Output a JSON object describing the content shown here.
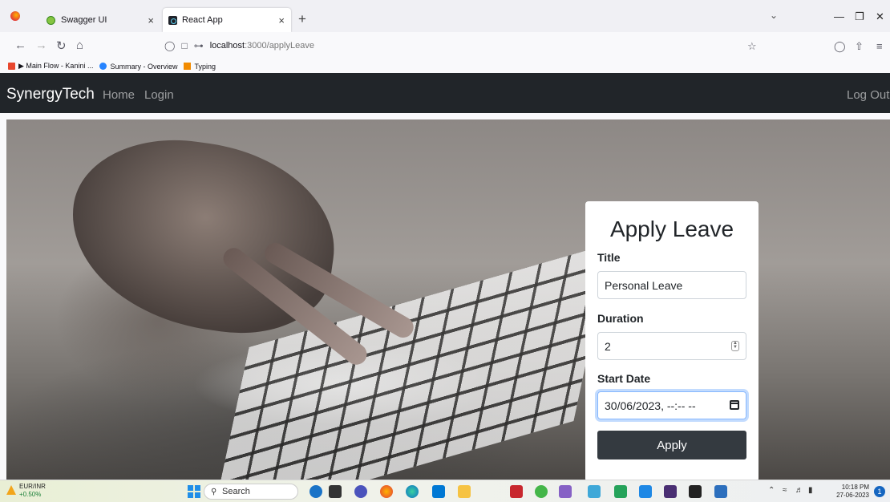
{
  "browser": {
    "tabs": [
      {
        "title": "Swagger UI",
        "active": false
      },
      {
        "title": "React App",
        "active": true
      }
    ],
    "url_host": "localhost",
    "url_path": ":3000/applyLeave",
    "bookmarks": [
      "▶ Main Flow - Kanini ...",
      "Summary - Overview",
      "Typing"
    ],
    "new_tab": "+",
    "tab_close": "×"
  },
  "app": {
    "brand": "SynergyTech",
    "nav": {
      "home": "Home",
      "login": "Login",
      "logout": "Log Out"
    }
  },
  "form": {
    "heading": "Apply Leave",
    "title_label": "Title",
    "title_value": "Personal Leave",
    "duration_label": "Duration",
    "duration_value": "2",
    "start_date_label": "Start Date",
    "start_date_value": "30/06/2023, --:-- --",
    "apply_label": "Apply"
  },
  "taskbar": {
    "ticker_name": "EUR/INR",
    "ticker_change": "+0.50%",
    "search_label": "Search",
    "time": "10:18 PM",
    "date": "27-06-2023",
    "notifications": "1"
  }
}
